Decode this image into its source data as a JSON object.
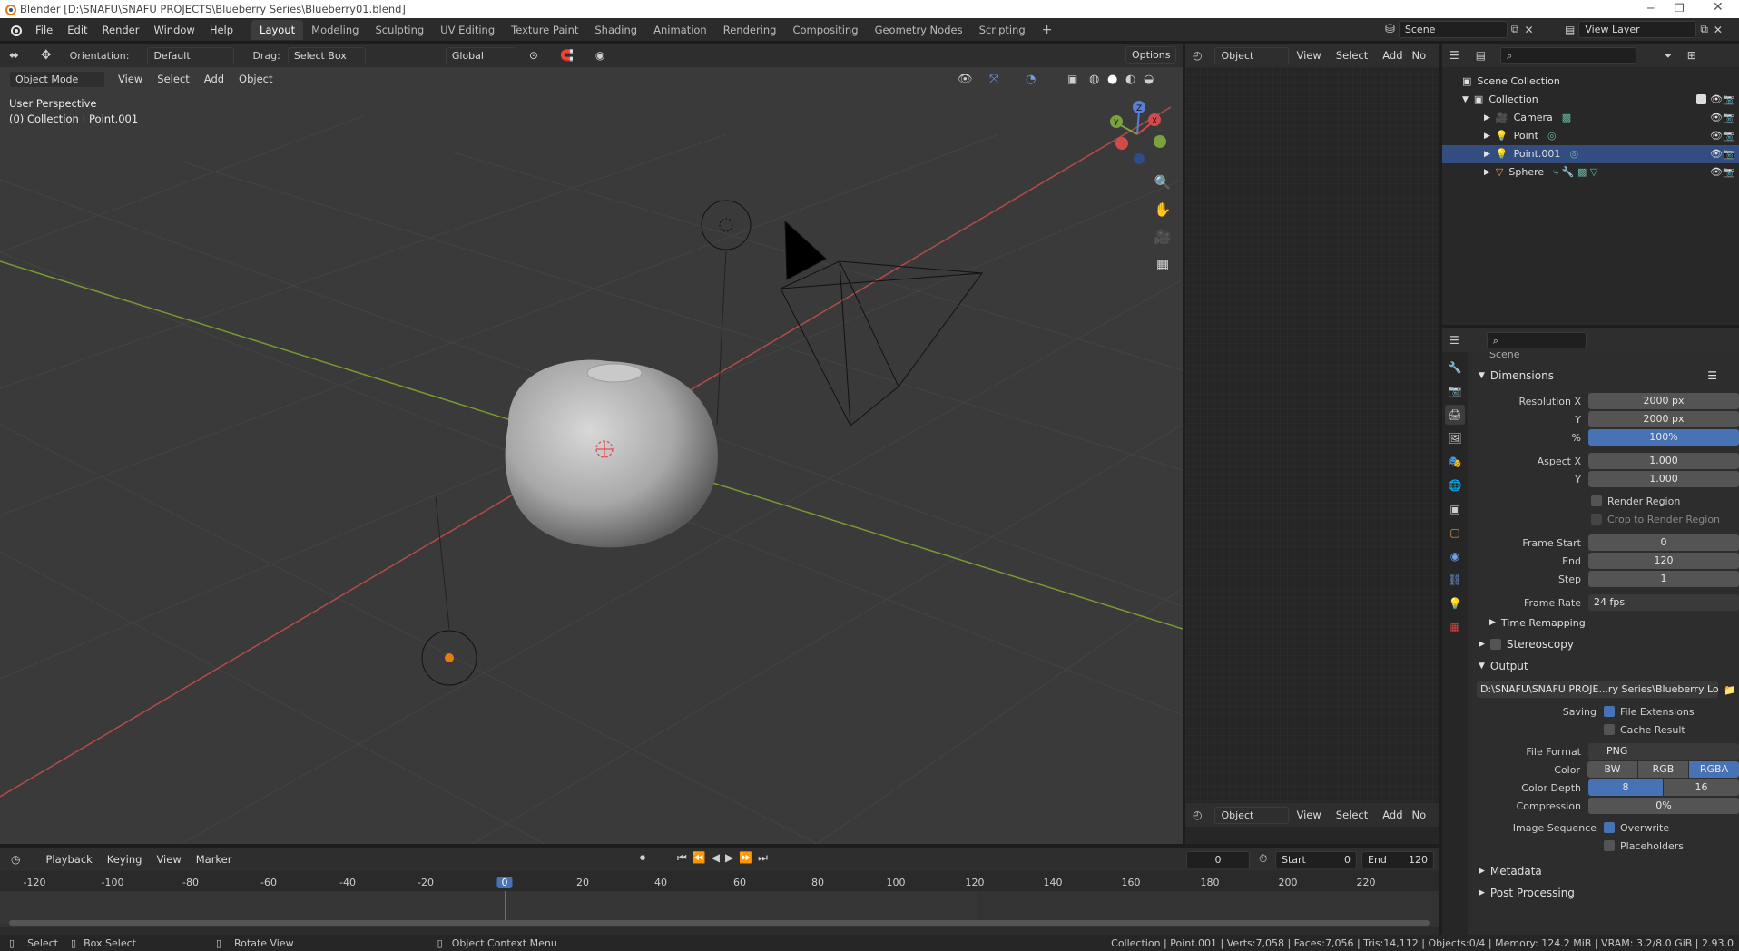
{
  "window": {
    "title": "Blender [D:\\SNAFU\\SNAFU PROJECTS\\Blueberry Series\\Blueberry01.blend]"
  },
  "menu": [
    "File",
    "Edit",
    "Render",
    "Window",
    "Help"
  ],
  "workspaces": [
    "Layout",
    "Modeling",
    "Sculpting",
    "UV Editing",
    "Texture Paint",
    "Shading",
    "Animation",
    "Rendering",
    "Compositing",
    "Geometry Nodes",
    "Scripting"
  ],
  "scene": {
    "name": "Scene",
    "view_layer": "View Layer"
  },
  "toolbar": {
    "orientation_label": "Orientation:",
    "orientation_value": "Default",
    "drag_label": "Drag:",
    "drag_value": "Select Box",
    "transform_value": "Global",
    "options": "Options"
  },
  "viewport": {
    "mode": "Object Mode",
    "menus": [
      "View",
      "Select",
      "Add",
      "Object"
    ],
    "perspective": "User Perspective",
    "collection_info": "(0) Collection | Point.001",
    "axis_x": "X",
    "axis_y": "Y",
    "axis_z": "Z"
  },
  "uv_editor": {
    "mode": "Object",
    "menus": [
      "View",
      "Select",
      "Add",
      "No"
    ]
  },
  "outliner": {
    "root": "Scene Collection",
    "collection": "Collection",
    "items": [
      {
        "name": "Camera",
        "color": "#e0a050"
      },
      {
        "name": "Point",
        "color": "#e0a050"
      },
      {
        "name": "Point.001",
        "color": "#e0a050"
      },
      {
        "name": "Sphere",
        "color": "#e0a050"
      }
    ]
  },
  "properties": {
    "scene_label": "Scene",
    "dimensions": "Dimensions",
    "res_x_label": "Resolution X",
    "res_x": "2000 px",
    "res_y_label": "Y",
    "res_y": "2000 px",
    "res_pct_label": "%",
    "res_pct": "100%",
    "aspect_x_label": "Aspect X",
    "aspect_x": "1.000",
    "aspect_y_label": "Y",
    "aspect_y": "1.000",
    "render_region": "Render Region",
    "crop_region": "Crop to Render Region",
    "frame_start_label": "Frame Start",
    "frame_start": "0",
    "end_label": "End",
    "end": "120",
    "step_label": "Step",
    "step": "1",
    "frame_rate_label": "Frame Rate",
    "frame_rate": "24 fps",
    "time_remapping": "Time Remapping",
    "stereoscopy": "Stereoscopy",
    "output": "Output",
    "output_path": "D:\\SNAFU\\SNAFU PROJE...ry Series\\Blueberry Loop\\",
    "saving_label": "Saving",
    "file_extensions": "File Extensions",
    "cache_result": "Cache Result",
    "file_format_label": "File Format",
    "file_format": "PNG",
    "color_label": "Color",
    "color_bw": "BW",
    "color_rgb": "RGB",
    "color_rgba": "RGBA",
    "color_depth_label": "Color Depth",
    "depth_8": "8",
    "depth_16": "16",
    "compression_label": "Compression",
    "compression": "0%",
    "image_sequence_label": "Image Sequence",
    "overwrite": "Overwrite",
    "placeholders": "Placeholders",
    "metadata": "Metadata",
    "post_processing": "Post Processing"
  },
  "timeline": {
    "menus": [
      "Playback",
      "Keying",
      "View",
      "Marker"
    ],
    "current_frame": "0",
    "start_label": "Start",
    "start": "0",
    "end_label": "End",
    "end": "120",
    "ticks": [
      "-120",
      "-100",
      "-80",
      "-60",
      "-40",
      "-20",
      "0",
      "20",
      "40",
      "60",
      "80",
      "100",
      "120",
      "140",
      "160",
      "180",
      "200",
      "220"
    ]
  },
  "status": {
    "select": "Select",
    "box_select": "Box Select",
    "rotate_view": "Rotate View",
    "context_menu": "Object Context Menu",
    "stats": "Collection | Point.001 | Verts:7,058 | Faces:7,056 | Tris:14,112 | Objects:0/4 | Memory: 124.2 MiB | VRAM: 3.2/8.0 GiB | 2.93.0"
  },
  "colors": {
    "accent": "#4772b3",
    "x_axis": "#b54b4b",
    "y_axis": "#7a9a2f",
    "selected_row": "#334d80"
  }
}
